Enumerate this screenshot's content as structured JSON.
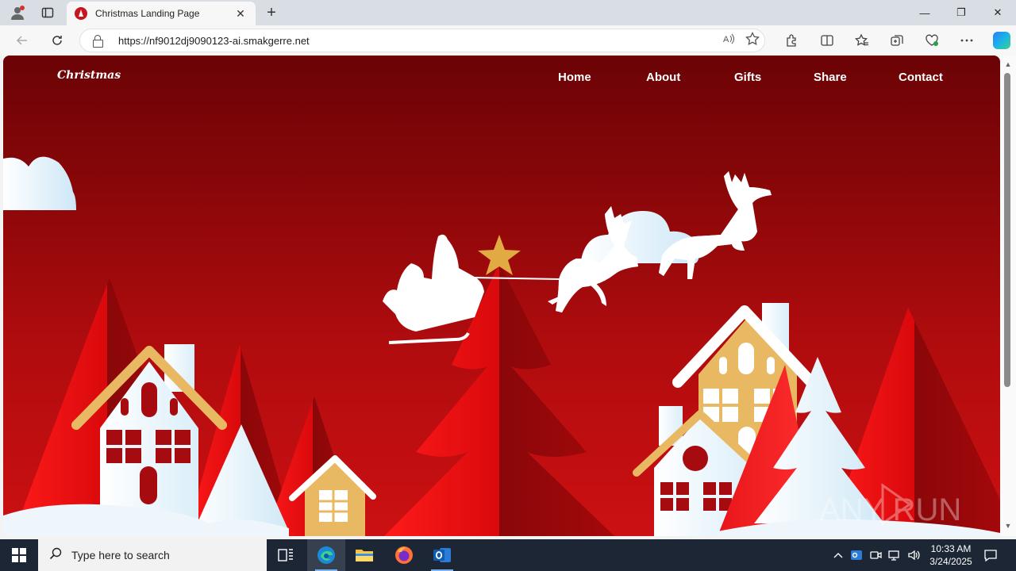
{
  "browser": {
    "tab_title": "Christmas Landing Page",
    "url": "https://nf9012dj9090123-ai.smakgerre.net",
    "tab_close_glyph": "✕",
    "new_tab_glyph": "+",
    "window_buttons": [
      "—",
      "❐",
      "✕"
    ]
  },
  "site": {
    "logo": "Christmas",
    "nav": [
      "Home",
      "About",
      "Gifts",
      "Share",
      "Contact"
    ]
  },
  "watermark": "ANY RUN",
  "taskbar": {
    "search_placeholder": "Type here to search",
    "time": "10:33 AM",
    "date": "3/24/2025"
  },
  "colors": {
    "background_top": "#6b0306",
    "background_bottom": "#cc1012",
    "tree_red": "#e0161a",
    "house_white": "#eef6fb",
    "roof_gold": "#e8b962",
    "taskbar": "#1c2635"
  },
  "icons": [
    "profile-icon",
    "tab-actions-icon",
    "back-icon",
    "reload-icon",
    "lock-icon",
    "read-aloud-icon",
    "favorite-star-icon",
    "extensions-icon",
    "split-screen-icon",
    "favorites-icon",
    "collections-icon",
    "browser-essentials-icon",
    "more-icon",
    "copilot-icon",
    "windows-start-icon",
    "search-icon",
    "task-view-icon",
    "edge-icon",
    "file-explorer-icon",
    "firefox-icon",
    "outlook-icon"
  ]
}
